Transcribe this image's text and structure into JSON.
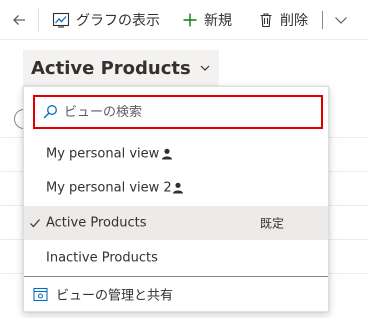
{
  "toolbar": {
    "chart_label": "グラフの表示",
    "new_label": "新規",
    "delete_label": "削除"
  },
  "view_selector": {
    "title": "Active Products"
  },
  "dropdown": {
    "search_placeholder": "ビューの検索",
    "items": [
      {
        "label": "My personal view",
        "personal": true,
        "selected": false,
        "badge": ""
      },
      {
        "label": "My personal view 2",
        "personal": true,
        "selected": false,
        "badge": ""
      },
      {
        "label": "Active Products",
        "personal": false,
        "selected": true,
        "badge": "既定"
      },
      {
        "label": "Inactive Products",
        "personal": false,
        "selected": false,
        "badge": ""
      }
    ],
    "manage_label": "ビューの管理と共有"
  },
  "colors": {
    "search_highlight": "#e00000",
    "selected_bg": "#edebe9",
    "accent": "#0f6cbd",
    "new_icon": "#107c10"
  }
}
